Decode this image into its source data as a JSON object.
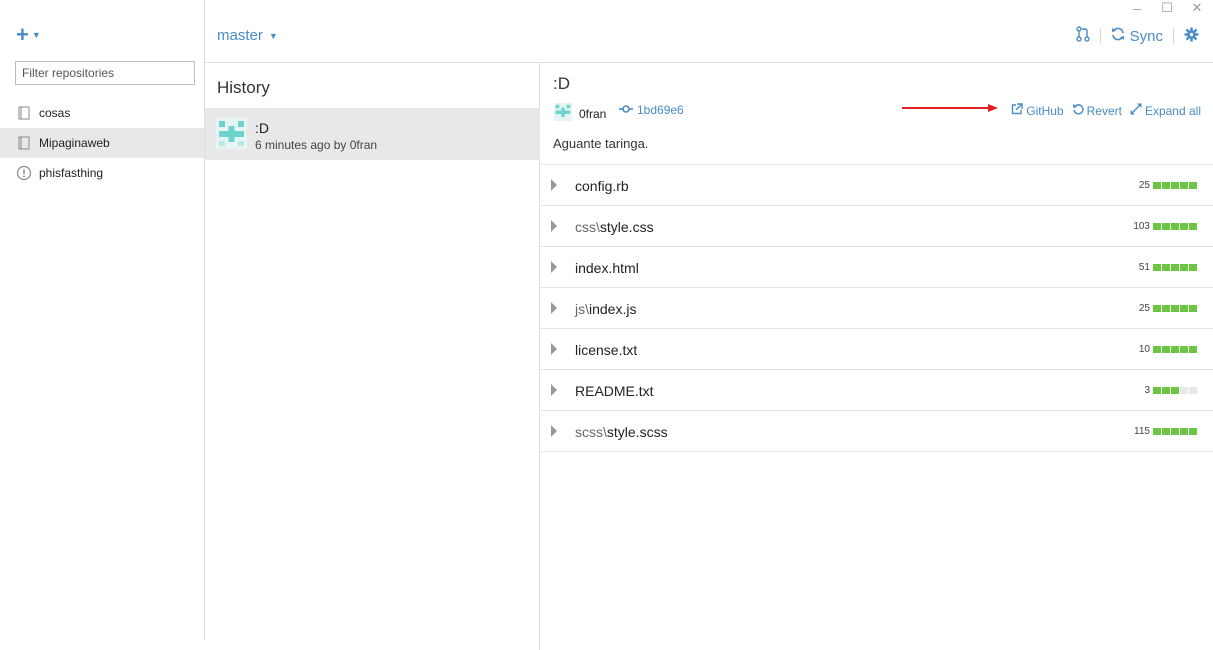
{
  "window": {
    "minimize_glyph": "–",
    "maximize_glyph": "☐",
    "close_glyph": "✕"
  },
  "sidebar": {
    "add_icon": "plus-icon",
    "filter_placeholder": "Filter repositories",
    "repos": [
      {
        "name": "cosas",
        "icon": "book-icon",
        "selected": false
      },
      {
        "name": "Mipaginaweb",
        "icon": "book-icon",
        "selected": true
      },
      {
        "name": "phisfasthing",
        "icon": "warning-circle-icon",
        "selected": false
      }
    ]
  },
  "toolbar": {
    "branch": "master",
    "sync_label": "Sync"
  },
  "history": {
    "title": "History",
    "commits": [
      {
        "title": ":D",
        "meta": "6 minutes ago by 0fran"
      }
    ]
  },
  "detail": {
    "title": ":D",
    "author": "0fran",
    "sha": "1bd69e6",
    "github_label": "GitHub",
    "revert_label": "Revert",
    "expand_label": "Expand all",
    "message": "Aguante taringa.",
    "files": [
      {
        "dir": "",
        "name": "config.rb",
        "changes": "25",
        "filled": 5
      },
      {
        "dir": "css\\",
        "name": "style.css",
        "changes": "103",
        "filled": 5
      },
      {
        "dir": "",
        "name": "index.html",
        "changes": "51",
        "filled": 5
      },
      {
        "dir": "js\\",
        "name": "index.js",
        "changes": "25",
        "filled": 5
      },
      {
        "dir": "",
        "name": "license.txt",
        "changes": "10",
        "filled": 5
      },
      {
        "dir": "",
        "name": "README.txt",
        "changes": "3",
        "filled": 3
      },
      {
        "dir": "scss\\",
        "name": "style.scss",
        "changes": "115",
        "filled": 5
      }
    ]
  },
  "colors": {
    "accent": "#4a8cc7",
    "additions": "#6cc644",
    "arrow": "#e02020"
  }
}
